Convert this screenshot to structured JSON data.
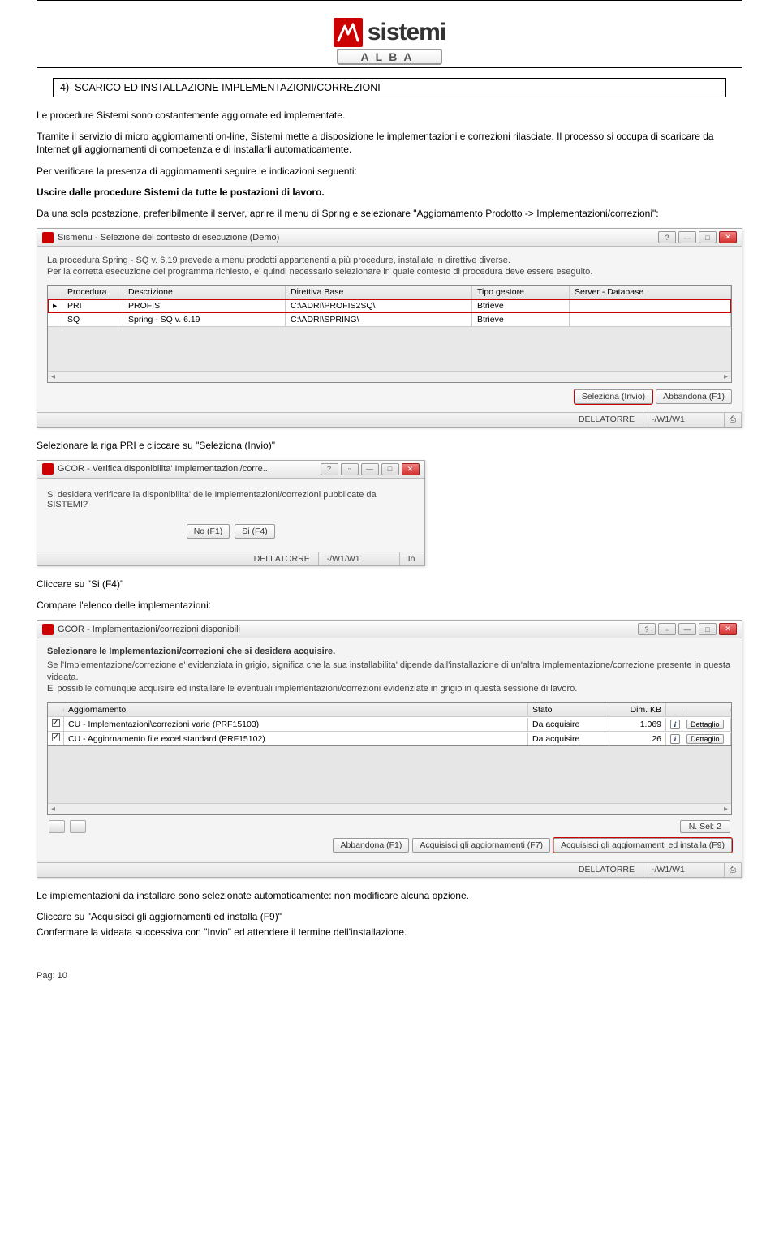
{
  "logo": {
    "brand": "sistemi",
    "sub": "ALBA"
  },
  "section": {
    "num": "4)",
    "title": "SCARICO ED INSTALLAZIONE IMPLEMENTAZIONI/CORREZIONI"
  },
  "paras": {
    "p1": "Le procedure Sistemi sono costantemente aggiornate ed implementate.",
    "p2": "Tramite il servizio di micro aggiornamenti on-line, Sistemi mette a disposizione le implementazioni e correzioni rilasciate. Il processo si occupa di scaricare da Internet gli aggiornamenti di competenza e di installarli automaticamente.",
    "p3": "Per verificare la presenza di aggiornamenti seguire le indicazioni seguenti:",
    "p4": "Uscire dalle procedure Sistemi da tutte le postazioni di lavoro.",
    "p5": "Da una sola postazione, preferibilmente il server, aprire il menu di Spring e selezionare \"Aggiornamento Prodotto -> Implementazioni/correzioni\":",
    "p6": "Selezionare la riga PRI e cliccare su \"Seleziona (Invio)\"",
    "p7": "Cliccare su \"Si (F4)\"",
    "p8": "Compare l'elenco delle implementazioni:",
    "p9": "Le implementazioni da installare sono selezionate automaticamente: non modificare alcuna opzione.",
    "p10": "Cliccare su \"Acquisisci gli aggiornamenti ed installa (F9)\"",
    "p11": "Confermare la videata successiva con \"Invio\" ed attendere il termine dell'installazione."
  },
  "ss1": {
    "title": "Sismenu - Selezione del contesto di esecuzione  (Demo)",
    "body1": "La procedura Spring - SQ v. 6.19 prevede a menu prodotti appartenenti a più procedure, installate in direttive diverse.",
    "body2": "Per la corretta esecuzione del programma richiesto, e' quindi necessario selezionare in quale contesto di procedura deve essere eseguito.",
    "cols": {
      "proc": "Procedura",
      "desc": "Descrizione",
      "dir": "Direttiva Base",
      "tipo": "Tipo gestore",
      "serv": "Server - Database"
    },
    "rows": [
      {
        "proc": "PRI",
        "desc": "PROFIS",
        "dir": "C:\\ADRI\\PROFIS2SQ\\",
        "tipo": "Btrieve",
        "serv": ""
      },
      {
        "proc": "SQ",
        "desc": "Spring - SQ v. 6.19",
        "dir": "C:\\ADRI\\SPRING\\",
        "tipo": "Btrieve",
        "serv": ""
      }
    ],
    "btn_seleziona": "Seleziona (Invio)",
    "btn_abbandona": "Abbandona (F1)",
    "status_user": "DELLATORRE",
    "status_term": "-/W1/W1"
  },
  "ss2": {
    "title": "GCOR - Verifica disponibilita' Implementazioni/corre...",
    "body": "Si desidera verificare la disponibilita' delle Implementazioni/correzioni pubblicate da SISTEMI?",
    "btn_no": "No (F1)",
    "btn_si": "Si (F4)",
    "status_user": "DELLATORRE",
    "status_term": "-/W1/W1",
    "status_mode": "In"
  },
  "ss3": {
    "title": "GCOR - Implementazioni/correzioni disponibili",
    "heading": "Selezionare le Implementazioni/correzioni che si desidera acquisire.",
    "body1": "Se l'Implementazione/correzione e' evidenziata in grigio, significa che la sua installabilita' dipende dall'installazione di un'altra Implementazione/correzione presente in questa videata.",
    "body2": "E' possibile comunque acquisire ed installare le eventuali implementazioni/correzioni evidenziate in grigio in questa sessione di lavoro.",
    "cols": {
      "agg": "Aggiornamento",
      "stato": "Stato",
      "dim": "Dim. KB"
    },
    "rows": [
      {
        "agg": "CU - Implementazioni\\correzioni varie (PRF15103)",
        "stato": "Da acquisire",
        "dim": "1.069",
        "det": "Dettaglio"
      },
      {
        "agg": "CU - Aggiornamento file excel standard (PRF15102)",
        "stato": "Da acquisire",
        "dim": "26",
        "det": "Dettaglio"
      }
    ],
    "sel_count": "N. Sel: 2",
    "btn_abbandona": "Abbandona (F1)",
    "btn_acquisisci": "Acquisisci gli aggiornamenti (F7)",
    "btn_acq_install": "Acquisisci gli aggiornamenti ed installa (F9)",
    "status_user": "DELLATORRE",
    "status_term": "-/W1/W1"
  },
  "footer": "Pag: 10"
}
